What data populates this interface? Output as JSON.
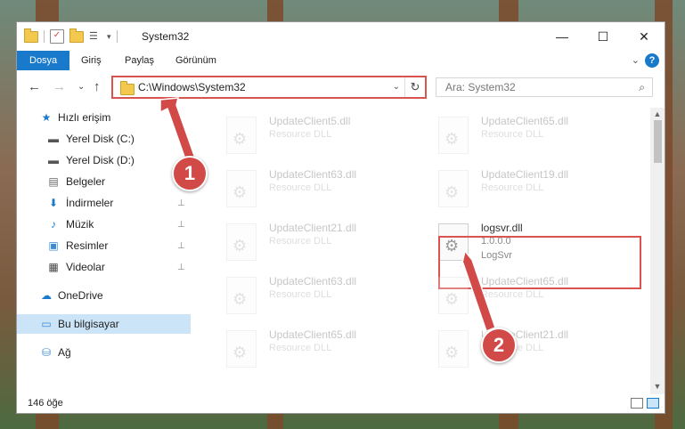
{
  "window": {
    "title": "System32",
    "minimize_glyph": "—",
    "maximize_glyph": "☐",
    "close_glyph": "✕"
  },
  "ribbon": {
    "tabs": [
      "Dosya",
      "Giriş",
      "Paylaş",
      "Görünüm"
    ],
    "help_glyph": "?",
    "chevron_glyph": "⌄"
  },
  "address": {
    "path": "C:\\Windows\\System32",
    "refresh_glyph": "↻",
    "dropdown_glyph": "⌄"
  },
  "search": {
    "placeholder": "Ara: System32",
    "icon_glyph": "⌕"
  },
  "nav_glyphs": {
    "back": "←",
    "forward": "→",
    "recent": "⌄",
    "up": "↑"
  },
  "sidebar": {
    "items": [
      {
        "label": "Hızlı erişim",
        "icon": "star-icon",
        "glyph": "★",
        "color": "#1979ca"
      },
      {
        "label": "Yerel Disk (C:)",
        "icon": "drive-icon",
        "glyph": "▬",
        "color": "#555555"
      },
      {
        "label": "Yerel Disk (D:)",
        "icon": "drive-icon",
        "glyph": "▬",
        "color": "#555555"
      },
      {
        "label": "Belgeler",
        "icon": "documents-icon",
        "glyph": "▤",
        "color": "#666666"
      },
      {
        "label": "İndirmeler",
        "icon": "download-icon",
        "glyph": "⬇",
        "color": "#1979ca",
        "pinned": true
      },
      {
        "label": "Müzik",
        "icon": "music-icon",
        "glyph": "♪",
        "color": "#1979ca",
        "pinned": true
      },
      {
        "label": "Resimler",
        "icon": "pictures-icon",
        "glyph": "▣",
        "color": "#3a8ad6",
        "pinned": true
      },
      {
        "label": "Videolar",
        "icon": "video-icon",
        "glyph": "▦",
        "color": "#444444",
        "pinned": true
      },
      {
        "label": "OneDrive",
        "icon": "cloud-icon",
        "glyph": "☁",
        "color": "#1979ca"
      },
      {
        "label": "Bu bilgisayar",
        "icon": "computer-icon",
        "glyph": "▭",
        "color": "#3a8ad6",
        "selected": true
      },
      {
        "label": "Ağ",
        "icon": "network-icon",
        "glyph": "⛁",
        "color": "#3a8ad6"
      }
    ],
    "pin_glyph": "📌"
  },
  "files": [
    {
      "name": "UpdateClient5.dll",
      "desc": "Resource DLL",
      "faded": true
    },
    {
      "name": "UpdateClient65.dll",
      "desc": "Resource DLL",
      "faded": true
    },
    {
      "name": "UpdateClient63.dll",
      "desc": "Resource DLL",
      "faded": true
    },
    {
      "name": "UpdateClient19.dll",
      "desc": "Resource DLL",
      "faded": true
    },
    {
      "name": "UpdateClient21.dll",
      "desc": "Resource DLL",
      "faded": true
    },
    {
      "name": "logsvr.dll",
      "version": "1.0.0.0",
      "desc": "LogSvr",
      "faded": false
    },
    {
      "name": "UpdateClient63.dll",
      "desc": "Resource DLL",
      "faded": true
    },
    {
      "name": "UpdateClient65.dll",
      "desc": "Resource DLL",
      "faded": true
    },
    {
      "name": "UpdateClient65.dll",
      "desc": "Resource DLL",
      "faded": true
    },
    {
      "name": "UpdateClient21.dll",
      "desc": "Resource DLL",
      "faded": true
    }
  ],
  "status": {
    "count": "146 öğe"
  },
  "callouts": {
    "one": "1",
    "two": "2",
    "color": "#d24a47"
  },
  "scroll_glyphs": {
    "up": "▲",
    "down": "▼"
  }
}
